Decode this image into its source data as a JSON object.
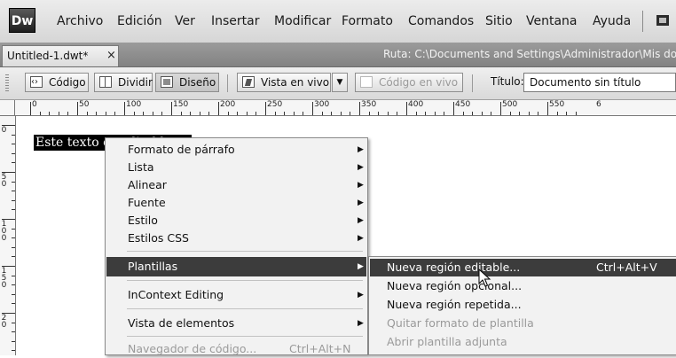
{
  "app": {
    "logo_text": "Dw",
    "menu": [
      "Archivo",
      "Edición",
      "Ver",
      "Insertar",
      "Modificar",
      "Formato",
      "Comandos",
      "Sitio",
      "Ventana",
      "Ayuda"
    ]
  },
  "document_bar": {
    "tab_label": "Untitled-1.dwt*",
    "close_glyph": "×",
    "path": "Ruta:  C:\\Documents and Settings\\Administrador\\Mis docu"
  },
  "toolbar": {
    "code_label": "Código",
    "split_label": "Dividir",
    "design_label": "Diseño",
    "live_view_label": "Vista en vivo",
    "live_code_label": "Código en vivo",
    "title_label": "Título:",
    "title_value": "Documento sin título"
  },
  "rulers": {
    "horizontal": [
      "0",
      "50",
      "100",
      "150",
      "200",
      "250",
      "300",
      "350",
      "400",
      "450",
      "500",
      "550",
      "6"
    ],
    "vertical": [
      "0",
      "5\n0",
      "1\n0\n0",
      "1\n5\n0",
      "2\n0"
    ]
  },
  "content": {
    "selected_text": "Este texto es editable"
  },
  "context_menu": {
    "items": [
      {
        "label": "Formato de párrafo",
        "submenu": true
      },
      {
        "label": "Lista",
        "submenu": true
      },
      {
        "label": "Alinear",
        "submenu": true
      },
      {
        "label": "Fuente",
        "submenu": true
      },
      {
        "label": "Estilo",
        "submenu": true
      },
      {
        "label": "Estilos CSS",
        "submenu": true
      },
      {
        "label": "Plantillas",
        "submenu": true,
        "highlighted": true
      },
      {
        "label": "InContext Editing",
        "submenu": true
      },
      {
        "label": "Vista de elementos",
        "submenu": true
      },
      {
        "label": "Navegador de código...",
        "shortcut": "Ctrl+Alt+N",
        "disabled": true
      }
    ]
  },
  "templates_submenu": {
    "items": [
      {
        "label": "Nueva región editable...",
        "shortcut": "Ctrl+Alt+V",
        "highlighted": true
      },
      {
        "label": "Nueva región opcional..."
      },
      {
        "label": "Nueva región repetida..."
      },
      {
        "label": "Quitar formato de plantilla",
        "disabled": true
      },
      {
        "label": "Abrir plantilla adjunta",
        "disabled": true
      }
    ]
  },
  "glyphs": {
    "submenu_arrow": "▶",
    "dropdown_arrow": "▼"
  }
}
